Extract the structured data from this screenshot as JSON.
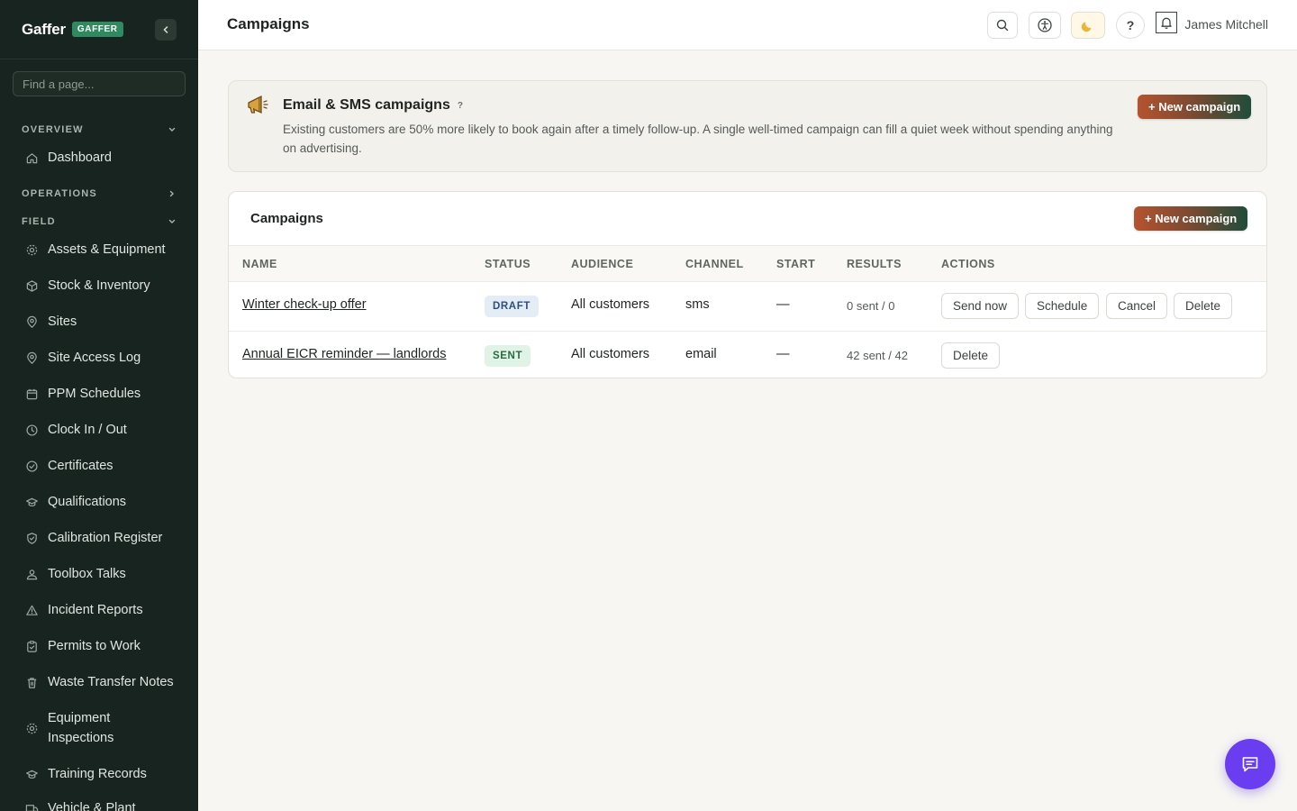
{
  "brand": {
    "name": "Gaffer",
    "badge": "GAFFER"
  },
  "sidebar": {
    "search_placeholder": "Find a page...",
    "sections": [
      {
        "label": "OVERVIEW",
        "chevron": "down"
      },
      {
        "label": "OPERATIONS",
        "chevron": "right"
      },
      {
        "label": "FIELD",
        "chevron": "down"
      }
    ],
    "overview_items": [
      {
        "label": "Dashboard",
        "icon": "home-icon"
      }
    ],
    "field_items": [
      {
        "label": "Assets & Equipment",
        "icon": "gear-icon"
      },
      {
        "label": "Stock & Inventory",
        "icon": "box-icon"
      },
      {
        "label": "Sites",
        "icon": "map-pin-icon"
      },
      {
        "label": "Site Access Log",
        "icon": "map-pin-icon"
      },
      {
        "label": "PPM Schedules",
        "icon": "calendar-icon"
      },
      {
        "label": "Clock In / Out",
        "icon": "clock-icon"
      },
      {
        "label": "Certificates",
        "icon": "check-circle-icon"
      },
      {
        "label": "Qualifications",
        "icon": "graduation-cap-icon"
      },
      {
        "label": "Calibration Register",
        "icon": "shield-check-icon"
      },
      {
        "label": "Toolbox Talks",
        "icon": "user-group-icon"
      },
      {
        "label": "Incident Reports",
        "icon": "warning-triangle-icon"
      },
      {
        "label": "Permits to Work",
        "icon": "clipboard-check-icon"
      },
      {
        "label": "Waste Transfer Notes",
        "icon": "trash-icon"
      },
      {
        "label": "Equipment Inspections",
        "label_line2": "Inspections",
        "label_line1": "Equipment",
        "icon": "gear-icon"
      },
      {
        "label": "Training Records",
        "icon": "graduation-cap-icon"
      },
      {
        "label": "Vehicle & Plant",
        "icon": "truck-icon"
      }
    ]
  },
  "header": {
    "title": "Campaigns",
    "user_name": "James Mitchell",
    "icons": [
      "search-icon",
      "accessibility-icon",
      "moon-icon",
      "help-icon",
      "bell-icon"
    ],
    "help_label": "?"
  },
  "info_card": {
    "title": "Email & SMS campaigns",
    "help": "?",
    "description": "Existing customers are 50% more likely to book again after a timely follow-up. A single well-timed campaign can fill a quiet week without spending anything on advertising.",
    "button_label": "+ New campaign"
  },
  "table_card": {
    "title": "Campaigns",
    "button_label": "+ New campaign",
    "columns": [
      "NAME",
      "STATUS",
      "AUDIENCE",
      "CHANNEL",
      "START",
      "RESULTS",
      "ACTIONS"
    ],
    "rows": [
      {
        "name": "Winter check-up offer",
        "status": "DRAFT",
        "audience": "All customers",
        "channel": "sms",
        "start": "—",
        "results": "0 sent / 0",
        "actions": [
          "Send now",
          "Schedule",
          "Cancel",
          "Delete"
        ]
      },
      {
        "name": "Annual EICR reminder — landlords",
        "status": "SENT",
        "audience": "All customers",
        "channel": "email",
        "start": "—",
        "results": "42 sent / 42",
        "actions": [
          "Delete"
        ]
      }
    ]
  },
  "colors": {
    "sidebar_bg": "#18241f",
    "accent_gradient_start": "#b5532f",
    "accent_gradient_end": "#1f4d3a",
    "draft_badge": "#e4ecf6",
    "sent_badge": "#e1f2e6",
    "chat_fab": "#6a3df0"
  }
}
